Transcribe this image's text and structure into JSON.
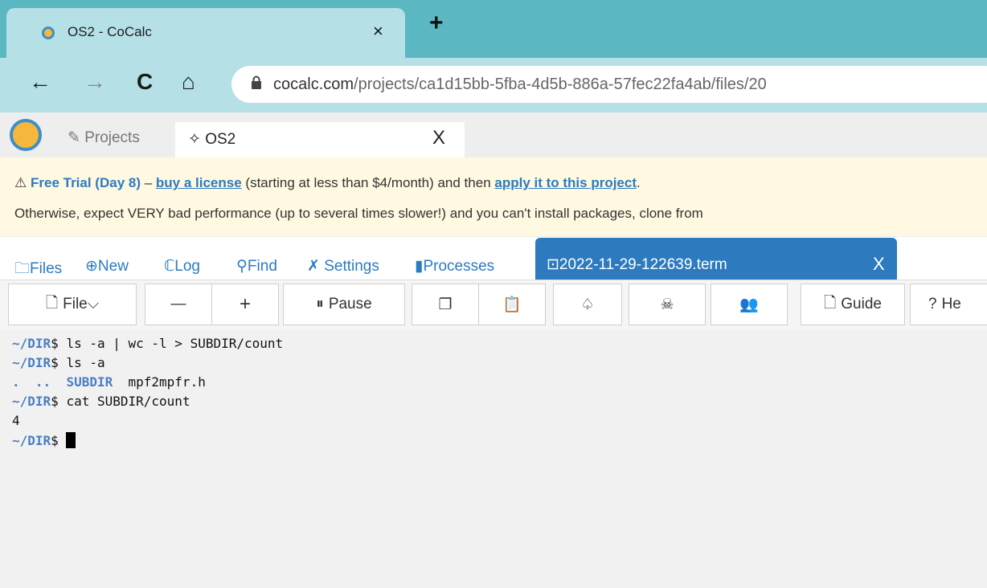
{
  "browser": {
    "tab_title": "OS2 - CoCalc",
    "tab_close": "×",
    "new_tab": "+",
    "back": "←",
    "forward": "→",
    "reload": "C",
    "home": "⌂",
    "url_host": "cocalc.com",
    "url_path": "/projects/ca1d15bb-5fba-4d5b-886a-57fec22fa4ab/files/20"
  },
  "cocalc": {
    "projects_label": "Projects",
    "project_tab": "OS2",
    "project_tab_close": "X"
  },
  "banner": {
    "warn_icon": "⚠",
    "trial": "Free Trial (Day 8)",
    "dash": " – ",
    "buy_link": "buy a license",
    "mid": " (starting at less than $4/month) and then ",
    "apply_link": "apply it to this project",
    "end": ".",
    "line2": "Otherwise, expect VERY bad performance (up to several times slower!) and you can't install packages, clone from"
  },
  "file_tabs": {
    "files": "Files",
    "new": "New",
    "log": "Log",
    "find": "Find",
    "settings": "Settings",
    "processes": "Processes",
    "active_file": "2022-11-29-122639.term",
    "active_close": "X"
  },
  "toolbar": {
    "file": "File",
    "minus": "—",
    "plus": "+",
    "pause": "Pause",
    "guide": "Guide",
    "help": "He"
  },
  "terminal": {
    "prompt": "~/DIR",
    "dollar": "$",
    "cmd1": " ls -a | wc -l > SUBDIR/count",
    "cmd2": " ls -a",
    "out_dots": ".  ..  ",
    "out_subdir": "SUBDIR",
    "out_file": "  mpf2mpfr.h",
    "cmd3": " cat SUBDIR/count",
    "out_count": "4"
  }
}
